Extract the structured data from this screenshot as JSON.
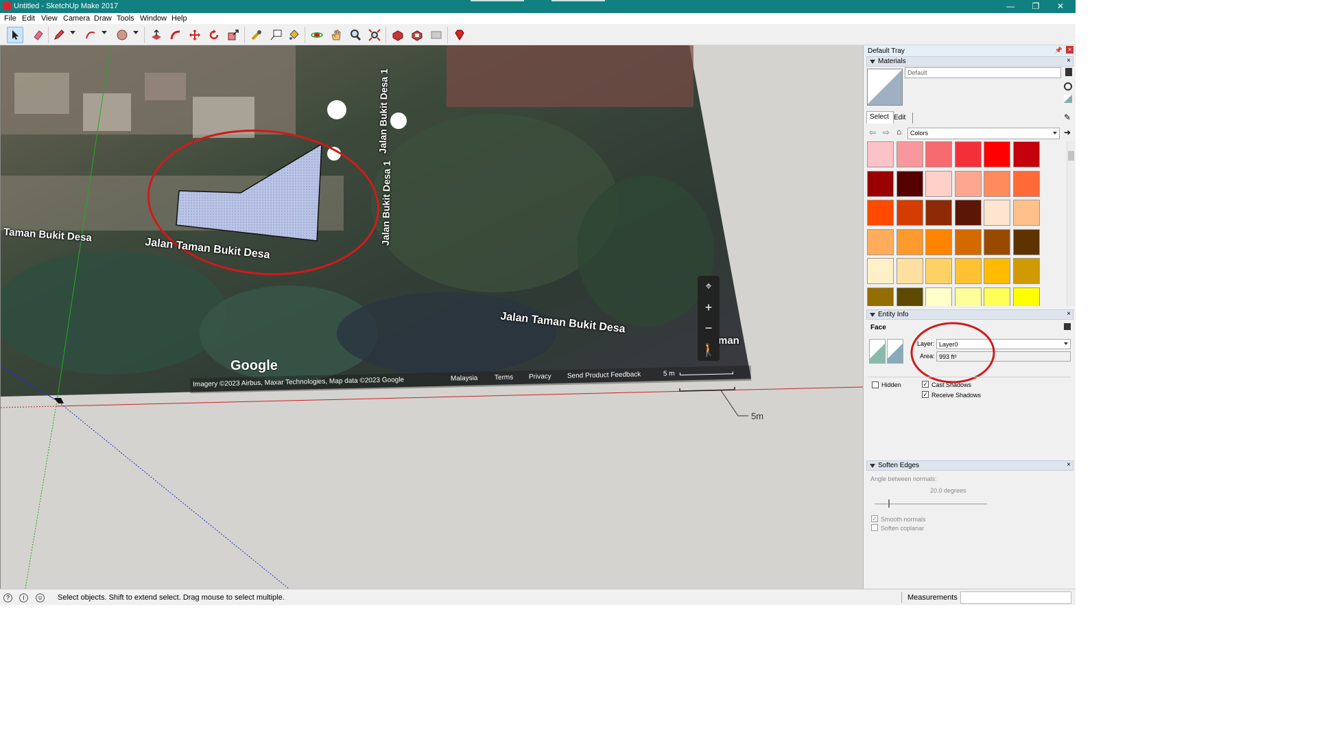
{
  "window": {
    "title": "Untitled - SketchUp Make 2017",
    "controls": [
      "—",
      "❐",
      "✕"
    ]
  },
  "menu": [
    "File",
    "Edit",
    "View",
    "Camera",
    "Draw",
    "Tools",
    "Window",
    "Help"
  ],
  "toolbar": {
    "tools": [
      "select-tool",
      "eraser-tool",
      "pencil-tool",
      "arc-tool",
      "shape-tool",
      "push-pull-tool",
      "follow-me-tool",
      "move-tool",
      "rotate-tool",
      "scale-tool",
      "tape-measure-tool",
      "text-tool",
      "paint-bucket-tool",
      "orbit-tool",
      "pan-tool",
      "zoom-tool",
      "zoom-extents-tool",
      "warehouse-tool",
      "extension-warehouse-tool",
      "layout-tool",
      "ruby-tool"
    ]
  },
  "viewport": {
    "map_labels": {
      "street_left": "Taman Bukit Desa",
      "street_main": "Jalan Taman Bukit Desa",
      "street_lower": "Jalan Taman Bukit Desa",
      "street_vertical_top": "Jalan Bukit Desa 1",
      "street_vertical_mid": "Jalan Bukit Desa 1",
      "edge_fragment": "man"
    },
    "google_logo": "Google",
    "attribution": {
      "imagery": "Imagery ©2023 Airbus, Maxar Technologies, Map data ©2023 Google",
      "country": "Malaysia",
      "terms": "Terms",
      "privacy": "Privacy",
      "feedback": "Send Product Feedback",
      "scale": "5 m"
    },
    "dimension_label": "5m"
  },
  "tray": {
    "title": "Default Tray",
    "materials": {
      "header": "Materials",
      "material_name": "Default",
      "tabs": [
        "Select",
        "Edit"
      ],
      "library": "Colors",
      "swatches": [
        "#fbc3c8",
        "#f8989d",
        "#f66b70",
        "#f3303a",
        "#ff0000",
        "#c3000c",
        "#9a0000",
        "#550000",
        "#ffd0c8",
        "#ffa690",
        "#ff8a5c",
        "#ff6a36",
        "#ff4a00",
        "#d43c00",
        "#8e2a06",
        "#5c1606",
        "#ffe4cf",
        "#ffc08a",
        "#ffad5c",
        "#ff9a2e",
        "#ff8400",
        "#d26a00",
        "#9a4a00",
        "#5e3300",
        "#fff0c8",
        "#ffe0a0",
        "#ffd266",
        "#ffc233",
        "#ffbb00",
        "#d09a00",
        "#946e00",
        "#5e4a00",
        "#ffffc8",
        "#ffff99",
        "#ffff55",
        "#ffff00"
      ]
    },
    "entity_info": {
      "header": "Entity Info",
      "entity_type": "Face",
      "layer_label": "Layer:",
      "layer_value": "Layer0",
      "area_label": "Area:",
      "area_value": "993 ft²",
      "hidden_label": "Hidden",
      "hidden_checked": false,
      "cast_shadows_label": "Cast Shadows",
      "cast_shadows_checked": true,
      "receive_shadows_label": "Receive Shadows",
      "receive_shadows_checked": true
    },
    "soften_edges": {
      "header": "Soften Edges",
      "angle_label": "Angle between normals:",
      "angle_value": "20.0  degrees",
      "smooth_normals_label": "Smooth normals",
      "smooth_normals_checked": true,
      "soften_coplanar_label": "Soften coplanar",
      "soften_coplanar_checked": false
    }
  },
  "status": {
    "message": "Select objects. Shift to extend select. Drag mouse to select multiple.",
    "measurements_label": "Measurements",
    "measurements_value": ""
  },
  "colors": {
    "titlebar": "#108080",
    "annotation_red": "#d01a1a",
    "face_fill": "#b9c4e6"
  }
}
